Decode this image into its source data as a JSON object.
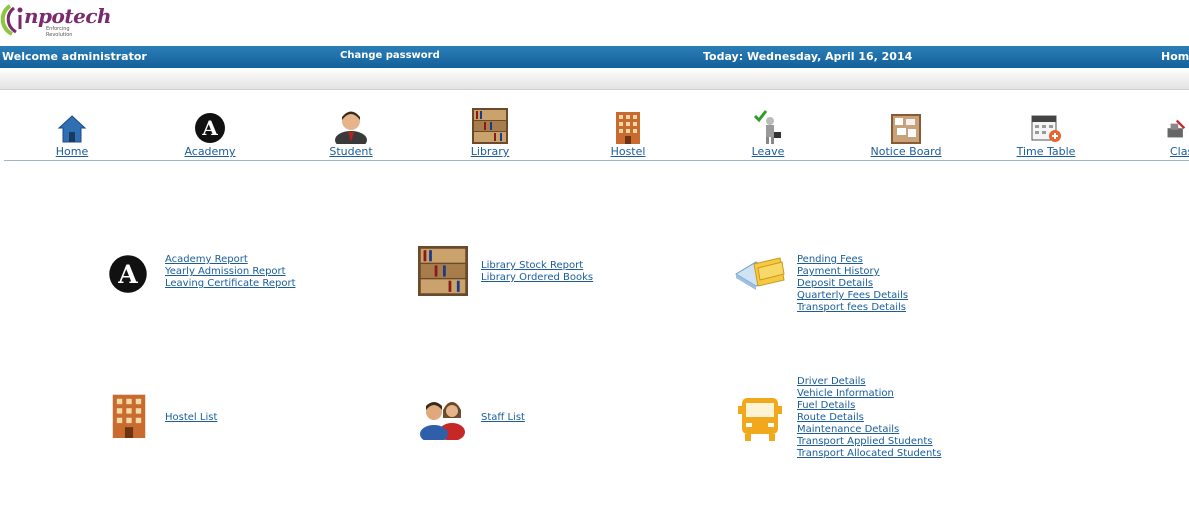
{
  "logo": {
    "text": "npotech",
    "tagline": "Enforcing Revolution"
  },
  "topbar": {
    "welcome": "Welcome administrator",
    "change_password": "Change password",
    "today": "Today: Wednesday, April 16, 2014",
    "home": "Home"
  },
  "nav": [
    {
      "label": "Home",
      "icon": "home-icon"
    },
    {
      "label": "Academy",
      "icon": "academy-icon"
    },
    {
      "label": "Student",
      "icon": "student-icon"
    },
    {
      "label": "Library",
      "icon": "library-icon"
    },
    {
      "label": "Hostel",
      "icon": "hostel-icon"
    },
    {
      "label": "Leave",
      "icon": "leave-icon"
    },
    {
      "label": "Notice Board",
      "icon": "notice-board-icon"
    },
    {
      "label": "Time Table",
      "icon": "time-table-icon"
    },
    {
      "label": "Clas",
      "icon": "class-icon"
    }
  ],
  "groups": {
    "academy": {
      "icon": "academy-icon",
      "links": [
        "Academy Report",
        "Yearly Admission Report",
        "Leaving Certificate Report"
      ]
    },
    "library": {
      "icon": "library-icon",
      "links": [
        "Library Stock Report",
        "Library Ordered Books"
      ]
    },
    "fees": {
      "icon": "fees-icon",
      "links": [
        "Pending Fees",
        "Payment History",
        "Deposit Details",
        "Quarterly Fees Details",
        "Transport fees Details"
      ]
    },
    "hostel": {
      "icon": "hostel-icon",
      "links": [
        "Hostel List"
      ]
    },
    "staff": {
      "icon": "staff-icon",
      "links": [
        "Staff List"
      ]
    },
    "transport": {
      "icon": "bus-icon",
      "links": [
        "Driver Details",
        "Vehicle Information",
        "Fuel Details",
        "Route Details",
        "Maintenance Details",
        "Transport Applied Students",
        "Transport Allocated Students"
      ]
    }
  }
}
